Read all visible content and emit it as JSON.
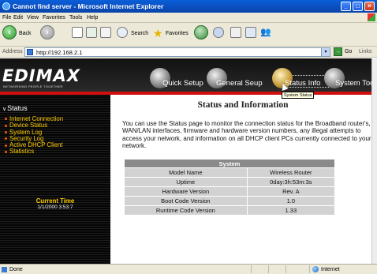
{
  "window": {
    "title": "Cannot find server - Microsoft Internet Explorer"
  },
  "menu": [
    "File",
    "Edit",
    "View",
    "Favorites",
    "Tools",
    "Help"
  ],
  "toolbar": {
    "back_label": "Back",
    "search_label": "Search",
    "favorites_label": "Favorites"
  },
  "address": {
    "label": "Address",
    "url": "http://192.168.2.1",
    "go_label": "Go",
    "links_label": "Links"
  },
  "banner": {
    "logo": "EDIMAX",
    "tagline": "NETWORKING PEOPLE TOGETHER",
    "nav": [
      {
        "label": "Quick Setup"
      },
      {
        "label": "General Seup"
      },
      {
        "label": "Status Info"
      },
      {
        "label": "System Tool"
      }
    ],
    "tooltip": "System Status"
  },
  "sidebar": {
    "title": "Status",
    "items": [
      {
        "label": "Internet Connection"
      },
      {
        "label": "Device Status"
      },
      {
        "label": "System Log"
      },
      {
        "label": "Security Log"
      },
      {
        "label": "Active DHCP Client"
      },
      {
        "label": "Statistics"
      }
    ],
    "current_time_label": "Current Time",
    "current_time_value": "1/1/2000 3:53:7"
  },
  "main": {
    "title": "Status and Information",
    "description": "You can use the Status page to monitor the connection status for the Broadband router's, WAN/LAN interfaces, firmware and hardware version numbers, any illegal attempts to access your network, and information on all DHCP client PCs currently connected to your network.",
    "table": {
      "header": "System",
      "rows": [
        {
          "name": "Model Name",
          "value": "Wireless Router"
        },
        {
          "name": "Uptime",
          "value": "0day:3h:53m:3s"
        },
        {
          "name": "Hardware Version",
          "value": "Rev. A"
        },
        {
          "name": "Boot Code Version",
          "value": "1.0"
        },
        {
          "name": "Runtime Code Version",
          "value": "1.33"
        }
      ]
    }
  },
  "statusbar": {
    "status_text": "Done",
    "zone": "Internet"
  }
}
